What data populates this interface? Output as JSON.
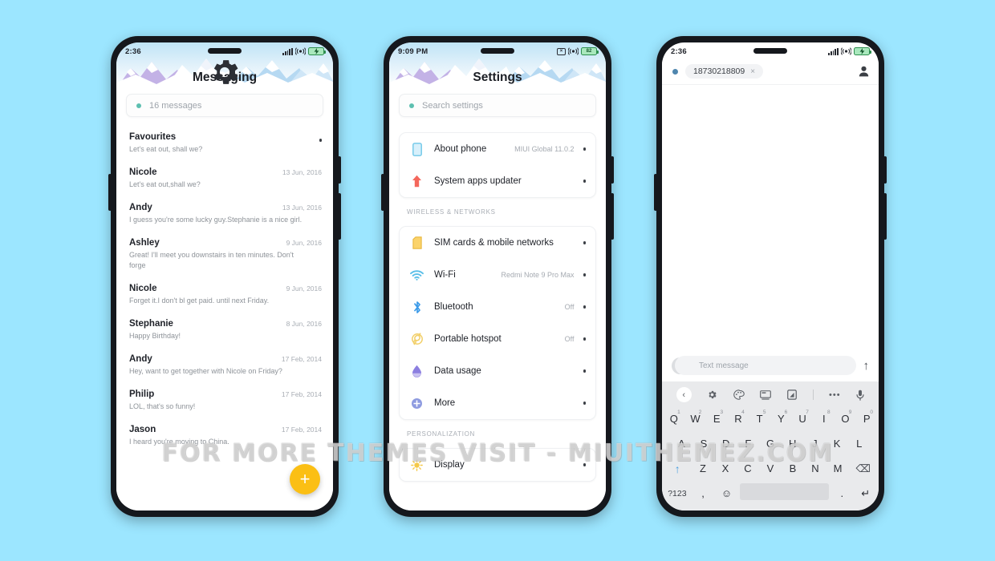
{
  "background_color": "#9ce6ff",
  "watermark": "FOR MORE THEMES VISIT - MIUITHEMEZ.COM",
  "colors": {
    "accent_fab": "#fbbf14",
    "teal_dot": "#5dbfb0",
    "battery_green": "#2d8f4e",
    "sky": "#bfe4f6",
    "peak_purple": "#b9a8e0",
    "peak_blue": "#a9d4ef"
  },
  "phone1": {
    "status": {
      "clock": "2:36",
      "signal_icon": "signal-bars-icon",
      "network_icon": "vibrate-icon",
      "battery_icon": "battery-charging-icon",
      "battery_text": ""
    },
    "header": {
      "title": "Messaging",
      "gear_icon": "gear-icon"
    },
    "search": {
      "placeholder": "16 messages",
      "dot_icon": "status-dot-icon"
    },
    "fab": {
      "icon": "plus-icon",
      "label": "+"
    },
    "messages": [
      {
        "name": "Favourites",
        "date": "",
        "preview": "Let's eat out, shall we?",
        "unread": true
      },
      {
        "name": "Nicole",
        "date": "13 Jun, 2016",
        "preview": "Let's eat out,shall we?",
        "unread": false
      },
      {
        "name": "Andy",
        "date": "13 Jun, 2016",
        "preview": "I guess you're some lucky guy.Stephanie is a nice girl.",
        "unread": false
      },
      {
        "name": "Ashley",
        "date": "9 Jun, 2016",
        "preview": "Great! I'll meet you downstairs in ten minutes. Don't forge",
        "unread": false
      },
      {
        "name": "Nicole",
        "date": "9 Jun, 2016",
        "preview": "Forget it.I don't bl get paid. until next Friday.",
        "unread": false
      },
      {
        "name": "Stephanie",
        "date": "8 Jun, 2016",
        "preview": "Happy Birthday!",
        "unread": false
      },
      {
        "name": "Andy",
        "date": "17 Feb, 2014",
        "preview": "Hey, want to get together with Nicole on Friday?",
        "unread": false
      },
      {
        "name": "Philip",
        "date": "17 Feb, 2014",
        "preview": "LOL, that's so funny!",
        "unread": false
      },
      {
        "name": "Jason",
        "date": "17 Feb, 2014",
        "preview": "I heard you're moving to China.",
        "unread": false
      }
    ]
  },
  "phone2": {
    "status": {
      "clock": "9:09 PM",
      "no_sim_icon": "no-sim-icon",
      "network_icon": "vibrate-icon",
      "battery_icon": "battery-icon",
      "battery_text": "82"
    },
    "header": {
      "title": "Settings"
    },
    "search": {
      "placeholder": "Search settings",
      "dot_icon": "status-dot-icon"
    },
    "groups": [
      {
        "section": "",
        "rows": [
          {
            "icon": "phone-outline-icon",
            "label": "About phone",
            "value": "MIUI Global 11.0.2"
          },
          {
            "icon": "up-arrow-icon",
            "label": "System apps updater",
            "value": ""
          }
        ]
      },
      {
        "section": "WIRELESS & NETWORKS",
        "rows": [
          {
            "icon": "sim-card-icon",
            "label": "SIM cards & mobile networks",
            "value": ""
          },
          {
            "icon": "wifi-icon",
            "label": "Wi-Fi",
            "value": "Redmi Note 9 Pro Max"
          },
          {
            "icon": "bluetooth-icon",
            "label": "Bluetooth",
            "value": "Off"
          },
          {
            "icon": "hotspot-icon",
            "label": "Portable hotspot",
            "value": "Off"
          },
          {
            "icon": "data-usage-icon",
            "label": "Data usage",
            "value": ""
          },
          {
            "icon": "more-icon",
            "label": "More",
            "value": ""
          }
        ]
      },
      {
        "section": "PERSONALIZATION",
        "rows": [
          {
            "icon": "display-icon",
            "label": "Display",
            "value": ""
          }
        ]
      }
    ]
  },
  "phone3": {
    "status": {
      "clock": "2:36",
      "signal_icon": "signal-bars-icon",
      "network_icon": "vibrate-icon",
      "battery_icon": "battery-charging-icon"
    },
    "recipient": {
      "number": "18730218809",
      "remove_label": "×",
      "dot_icon": "status-dot-icon",
      "contact_icon": "person-icon"
    },
    "compose": {
      "placeholder": "Text message",
      "attach_label": "+",
      "send_icon": "send-arrow-icon",
      "send_label": "↑"
    },
    "keyboard": {
      "toolbar": [
        {
          "icon": "chevron-left-icon",
          "label": "‹"
        },
        {
          "icon": "gear-icon",
          "label": "⚙"
        },
        {
          "icon": "palette-icon",
          "label": "🎨"
        },
        {
          "icon": "sticker-icon",
          "label": "⌨"
        },
        {
          "icon": "clipboard-icon",
          "label": "◳"
        },
        {
          "icon": "more-dots-icon",
          "label": "•••"
        },
        {
          "icon": "microphone-icon",
          "label": "⌇"
        }
      ],
      "row1": [
        {
          "key": "Q",
          "num": "1"
        },
        {
          "key": "W",
          "num": "2"
        },
        {
          "key": "E",
          "num": "3"
        },
        {
          "key": "R",
          "num": "4"
        },
        {
          "key": "T",
          "num": "5"
        },
        {
          "key": "Y",
          "num": "6"
        },
        {
          "key": "U",
          "num": "7"
        },
        {
          "key": "I",
          "num": "8"
        },
        {
          "key": "O",
          "num": "9"
        },
        {
          "key": "P",
          "num": "0"
        }
      ],
      "row2": [
        "A",
        "S",
        "D",
        "F",
        "G",
        "H",
        "J",
        "K",
        "L"
      ],
      "row3": {
        "shift": "↑",
        "keys": [
          "Z",
          "X",
          "C",
          "V",
          "B",
          "N",
          "M"
        ],
        "delete": "⌫"
      },
      "row4": {
        "symbols": "?123",
        "comma": ",",
        "emoji": "☺",
        "space": "",
        "period": ".",
        "enter": "↵"
      }
    }
  }
}
